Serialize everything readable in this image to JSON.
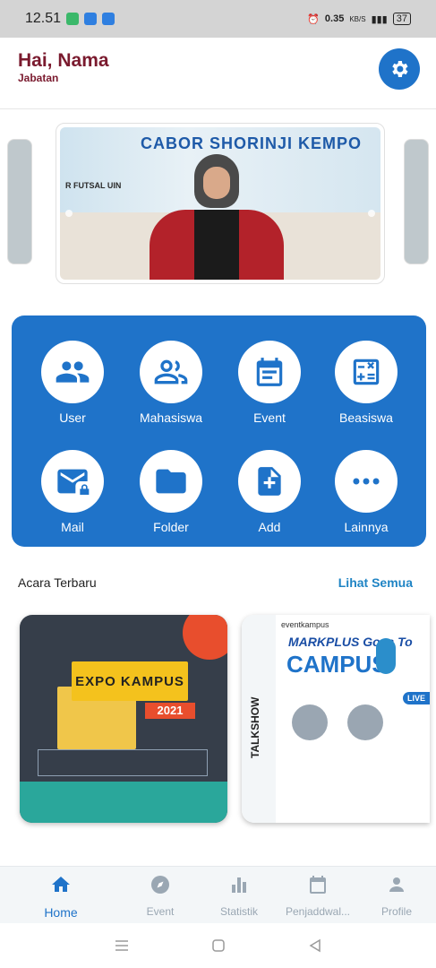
{
  "status_bar": {
    "time": "12.51",
    "data_rate": "0.35",
    "data_unit": "KB/S",
    "battery": "37"
  },
  "header": {
    "greeting": "Hai, Nama",
    "role": "Jabatan",
    "settings_icon": "gear-icon"
  },
  "carousel": {
    "banner_title": "CABOR SHORINJI KEMPO",
    "banner_sub": "R FUTSAL UIN"
  },
  "menu": {
    "background": "#1f73c9",
    "items": [
      {
        "label": "User",
        "icon": "users-icon"
      },
      {
        "label": "Mahasiswa",
        "icon": "people-outline-icon"
      },
      {
        "label": "Event",
        "icon": "calendar-icon"
      },
      {
        "label": "Beasiswa",
        "icon": "calculator-icon"
      },
      {
        "label": "Mail",
        "icon": "mail-lock-icon"
      },
      {
        "label": "Folder",
        "icon": "folder-icon"
      },
      {
        "label": "Add",
        "icon": "add-file-icon"
      },
      {
        "label": "Lainnya",
        "icon": "more-icon"
      }
    ]
  },
  "events_section": {
    "title": "Acara Terbaru",
    "see_all": "Lihat Semua",
    "posters": [
      {
        "title_line1": "EXPO KAMPUS",
        "year": "2021"
      },
      {
        "brand": "eventkampus",
        "title_line1": "MARKPLUS Goes To",
        "title_line2": "CAMPUS",
        "side_label": "TALKSHOW",
        "live": "LIVE"
      }
    ]
  },
  "bottom_nav": {
    "accent": "#1f73c9",
    "inactive": "#9aa7b3",
    "items": [
      {
        "label": "Home",
        "icon": "home-icon",
        "active": true
      },
      {
        "label": "Event",
        "icon": "compass-icon",
        "active": false
      },
      {
        "label": "Statistik",
        "icon": "bar-chart-icon",
        "active": false
      },
      {
        "label": "Penjaddwal...",
        "icon": "calendar-icon",
        "active": false
      },
      {
        "label": "Profile",
        "icon": "person-icon",
        "active": false
      }
    ]
  }
}
